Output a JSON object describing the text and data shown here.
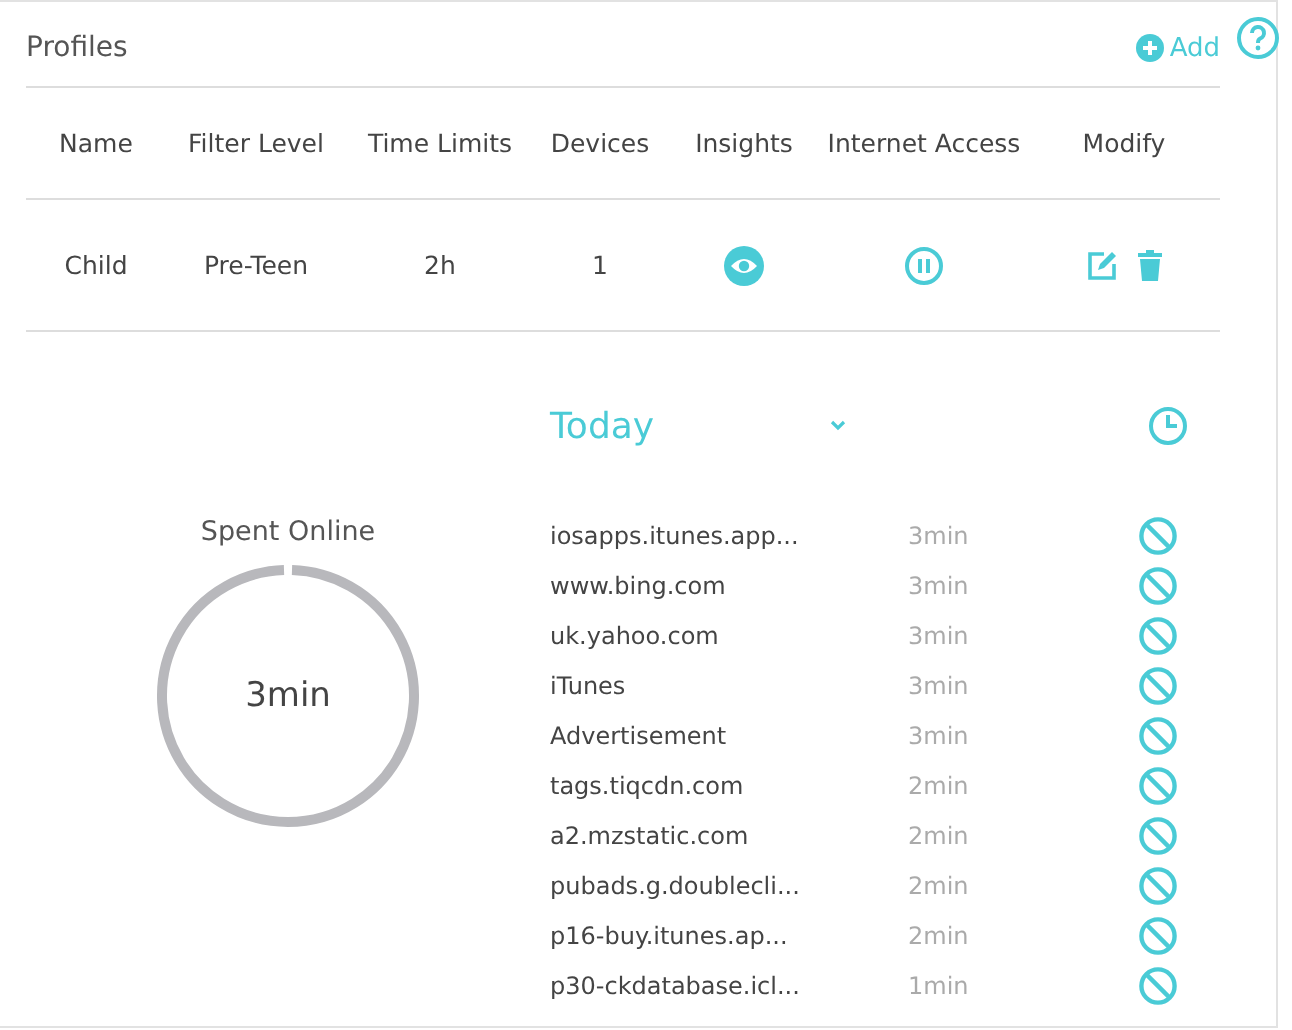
{
  "profiles": {
    "title": "Profiles",
    "add_label": "Add",
    "columns": [
      "Name",
      "Filter Level",
      "Time Limits",
      "Devices",
      "Insights",
      "Internet Access",
      "Modify"
    ],
    "rows": [
      {
        "name": "Child",
        "filter_level": "Pre-Teen",
        "time_limits": "2h",
        "devices": "1"
      }
    ]
  },
  "insights": {
    "period": "Today",
    "spent_label": "Spent Online",
    "spent_value": "3min",
    "sites": [
      {
        "name": "iosapps.itunes.app...",
        "time": "3min"
      },
      {
        "name": "www.bing.com",
        "time": "3min"
      },
      {
        "name": "uk.yahoo.com",
        "time": "3min"
      },
      {
        "name": "iTunes",
        "time": "3min"
      },
      {
        "name": "Advertisement",
        "time": "3min"
      },
      {
        "name": "tags.tiqcdn.com",
        "time": "2min"
      },
      {
        "name": "a2.mzstatic.com",
        "time": "2min"
      },
      {
        "name": "pubads.g.doublecli...",
        "time": "2min"
      },
      {
        "name": "p16-buy.itunes.ap...",
        "time": "2min"
      },
      {
        "name": "p30-ckdatabase.icl...",
        "time": "1min"
      }
    ]
  }
}
